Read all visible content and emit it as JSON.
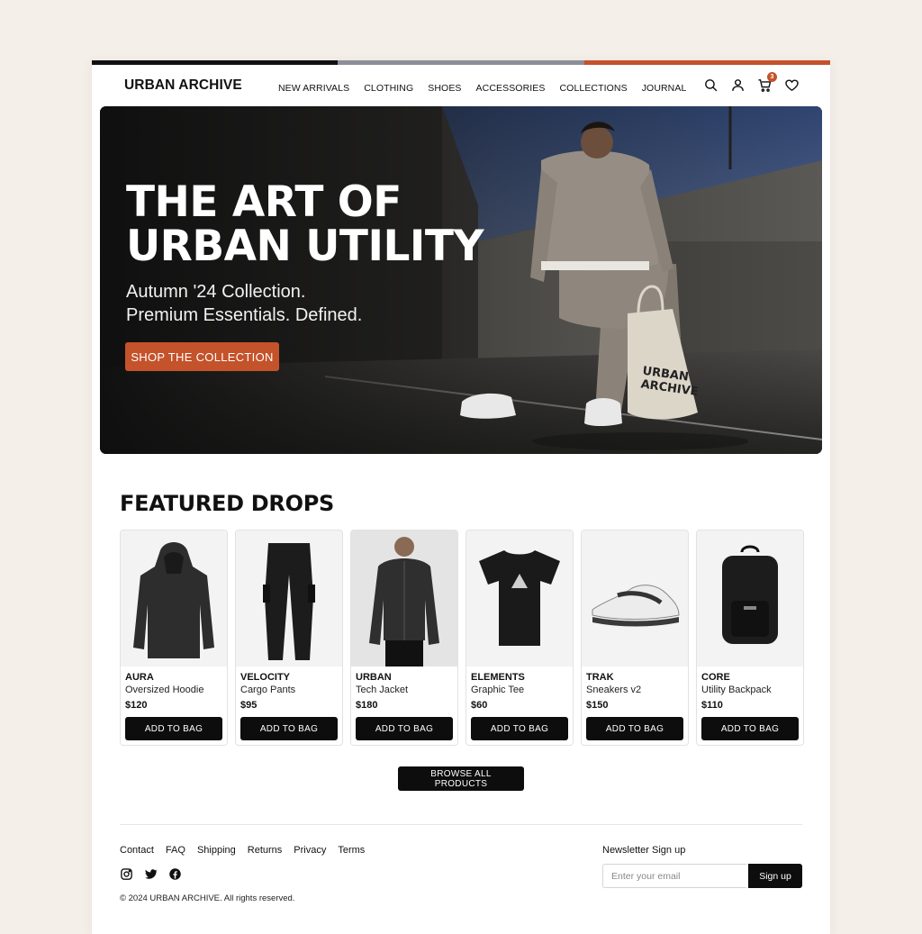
{
  "colors": {
    "accent": "#c4522a",
    "topbar": [
      "#111111",
      "#8a8f99",
      "#c4522a"
    ],
    "button_dark": "#0d0d0d",
    "background": "#f5efe9"
  },
  "header": {
    "logo": "URBAN ARCHIVE",
    "nav": [
      "NEW ARRIVALS",
      "CLOTHING",
      "SHOES",
      "ACCESSORIES",
      "COLLECTIONS",
      "JOURNAL"
    ],
    "icons": [
      "search-icon",
      "user-icon",
      "cart-icon",
      "heart-icon"
    ],
    "cart_count": "3"
  },
  "hero": {
    "title_line1": "THE ART OF",
    "title_line2": "URBAN UTILITY",
    "sub_line1": "Autumn '24 Collection.",
    "sub_line2": "Premium Essentials. Defined.",
    "cta": "SHOP THE COLLECTION",
    "bag_text_1": "URBAN",
    "bag_text_2": "ARCHIVE"
  },
  "featured": {
    "title": "FEATURED DROPS",
    "add_label": "ADD TO BAG",
    "products": [
      {
        "brand": "AURA",
        "name": "Oversized Hoodie",
        "price": "$120",
        "icon": "hoodie-icon"
      },
      {
        "brand": "VELOCITY",
        "name": "Cargo Pants",
        "price": "$95",
        "icon": "pants-icon"
      },
      {
        "brand": "URBAN",
        "name": "Tech Jacket",
        "price": "$180",
        "icon": "jacket-icon"
      },
      {
        "brand": "ELEMENTS",
        "name": "Graphic Tee",
        "price": "$60",
        "icon": "tshirt-icon"
      },
      {
        "brand": "TRAK",
        "name": "Sneakers v2",
        "price": "$150",
        "icon": "sneaker-icon"
      },
      {
        "brand": "CORE",
        "name": "Utility Backpack",
        "price": "$110",
        "icon": "backpack-icon"
      }
    ],
    "browse_label": "BROWSE ALL PRODUCTS"
  },
  "footer": {
    "links": [
      "Contact",
      "FAQ",
      "Shipping",
      "Returns",
      "Privacy",
      "Terms"
    ],
    "socials": [
      "instagram-icon",
      "twitter-icon",
      "facebook-icon"
    ],
    "copyright": "© 2024 URBAN ARCHIVE. All rights reserved.",
    "newsletter_label": "Newsletter Sign up",
    "newsletter_placeholder": "Enter your email",
    "newsletter_button": "Sign up"
  }
}
